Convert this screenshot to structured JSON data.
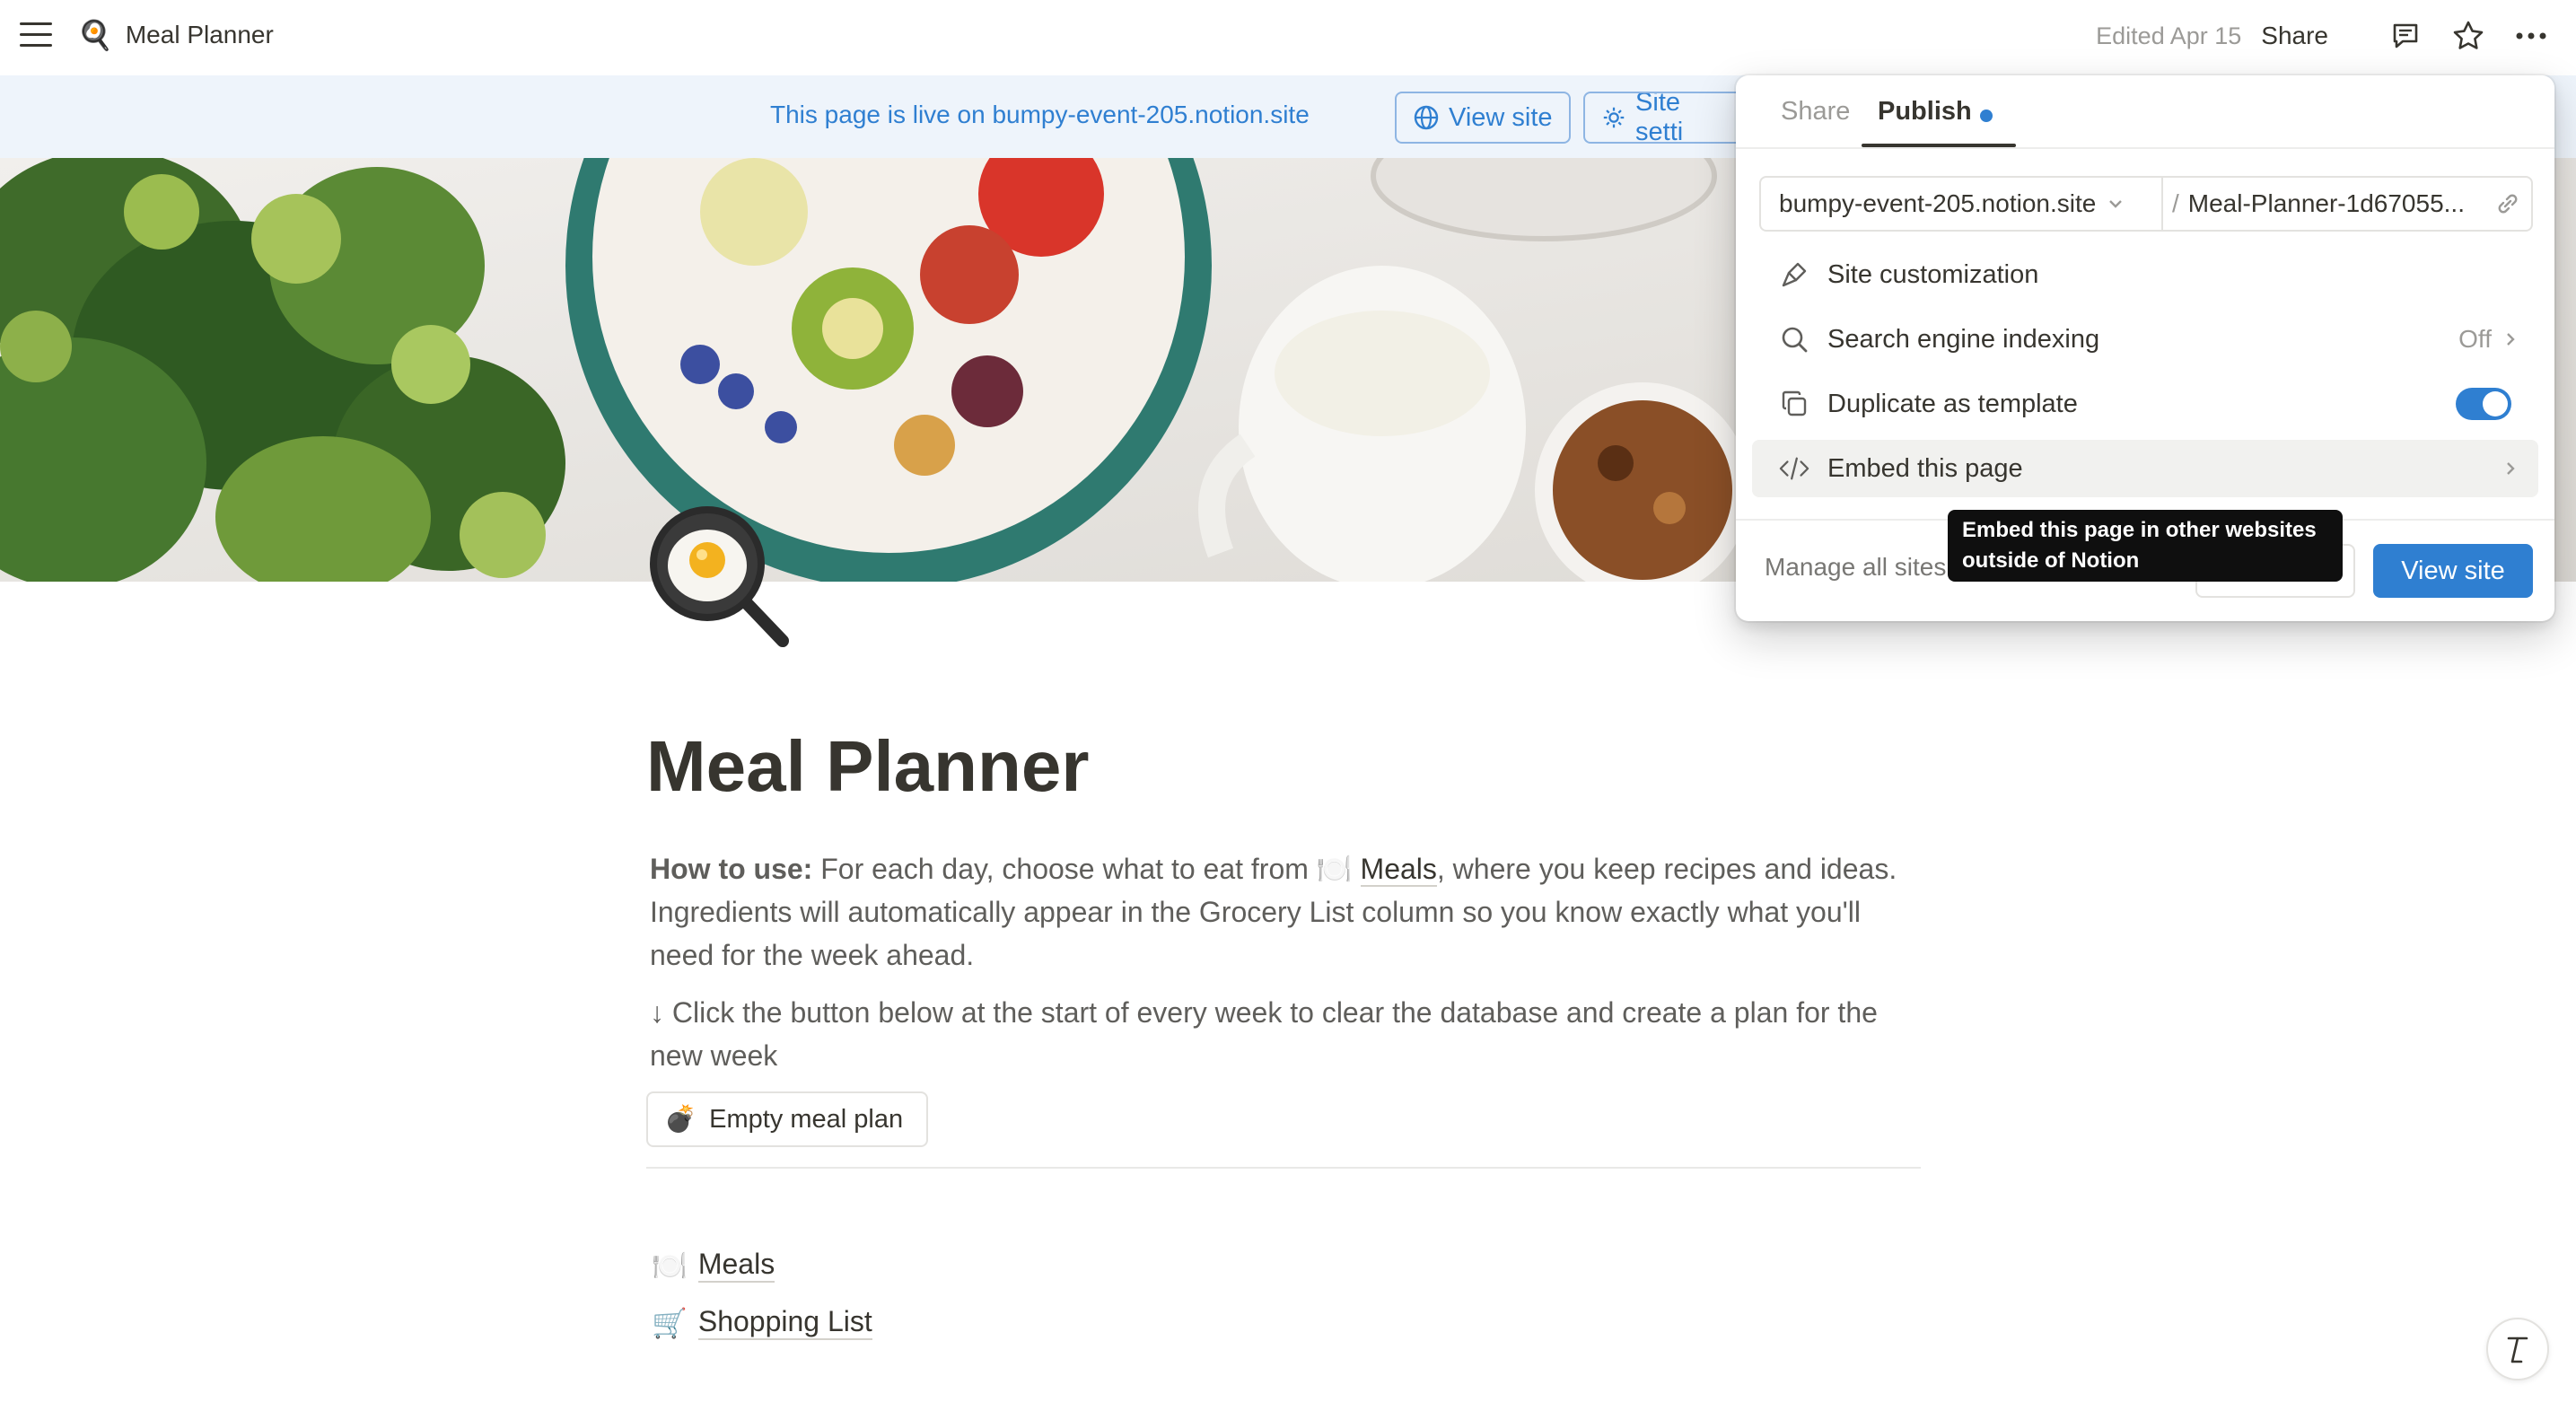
{
  "topbar": {
    "title": "Meal Planner",
    "title_emoji": "🍳",
    "edited": "Edited Apr 15",
    "share": "Share"
  },
  "banner": {
    "text": "This page is live on bumpy-event-205.notion.site",
    "view_site": "View site",
    "site_settings": "Site setti"
  },
  "page": {
    "icon": "🍳",
    "title": "Meal Planner",
    "howto_label": "How to use:",
    "howto_text_1": " For each day, choose what to eat from ",
    "meals_emoji": "🍽️",
    "meals_link": "Meals",
    "howto_text_2": ", where you keep recipes and ideas. Ingredients will automatically appear in the Grocery List column so you know exactly what you'll need for the week ahead.",
    "instruction": "↓ Click the button below at the start of every week to clear the database and create a plan for the new week",
    "empty_button_emoji": "💣",
    "empty_button": "Empty meal plan",
    "links": [
      {
        "emoji": "🍽️",
        "label": "Meals"
      },
      {
        "emoji": "🛒",
        "label": "Shopping List"
      }
    ]
  },
  "publish_popup": {
    "tabs": [
      "Share",
      "Publish"
    ],
    "domain": "bumpy-event-205.notion.site",
    "slash": "/",
    "path": "Meal-Planner-1d67055...",
    "rows": [
      {
        "label": "Site customization",
        "icon": "brush-icon"
      },
      {
        "label": "Search engine indexing",
        "value": "Off",
        "icon": "search-icon"
      },
      {
        "label": "Duplicate as template",
        "icon": "duplicate-icon",
        "toggle": true
      },
      {
        "label": "Embed this page",
        "icon": "code-icon"
      }
    ],
    "manage": "Manage all sites",
    "view_site": "View site",
    "tooltip": "Embed this page in other websites outside of Notion"
  },
  "colors": {
    "accent": "#2f7fd1",
    "banner_bg": "#eef4fb",
    "text": "#37352f"
  }
}
